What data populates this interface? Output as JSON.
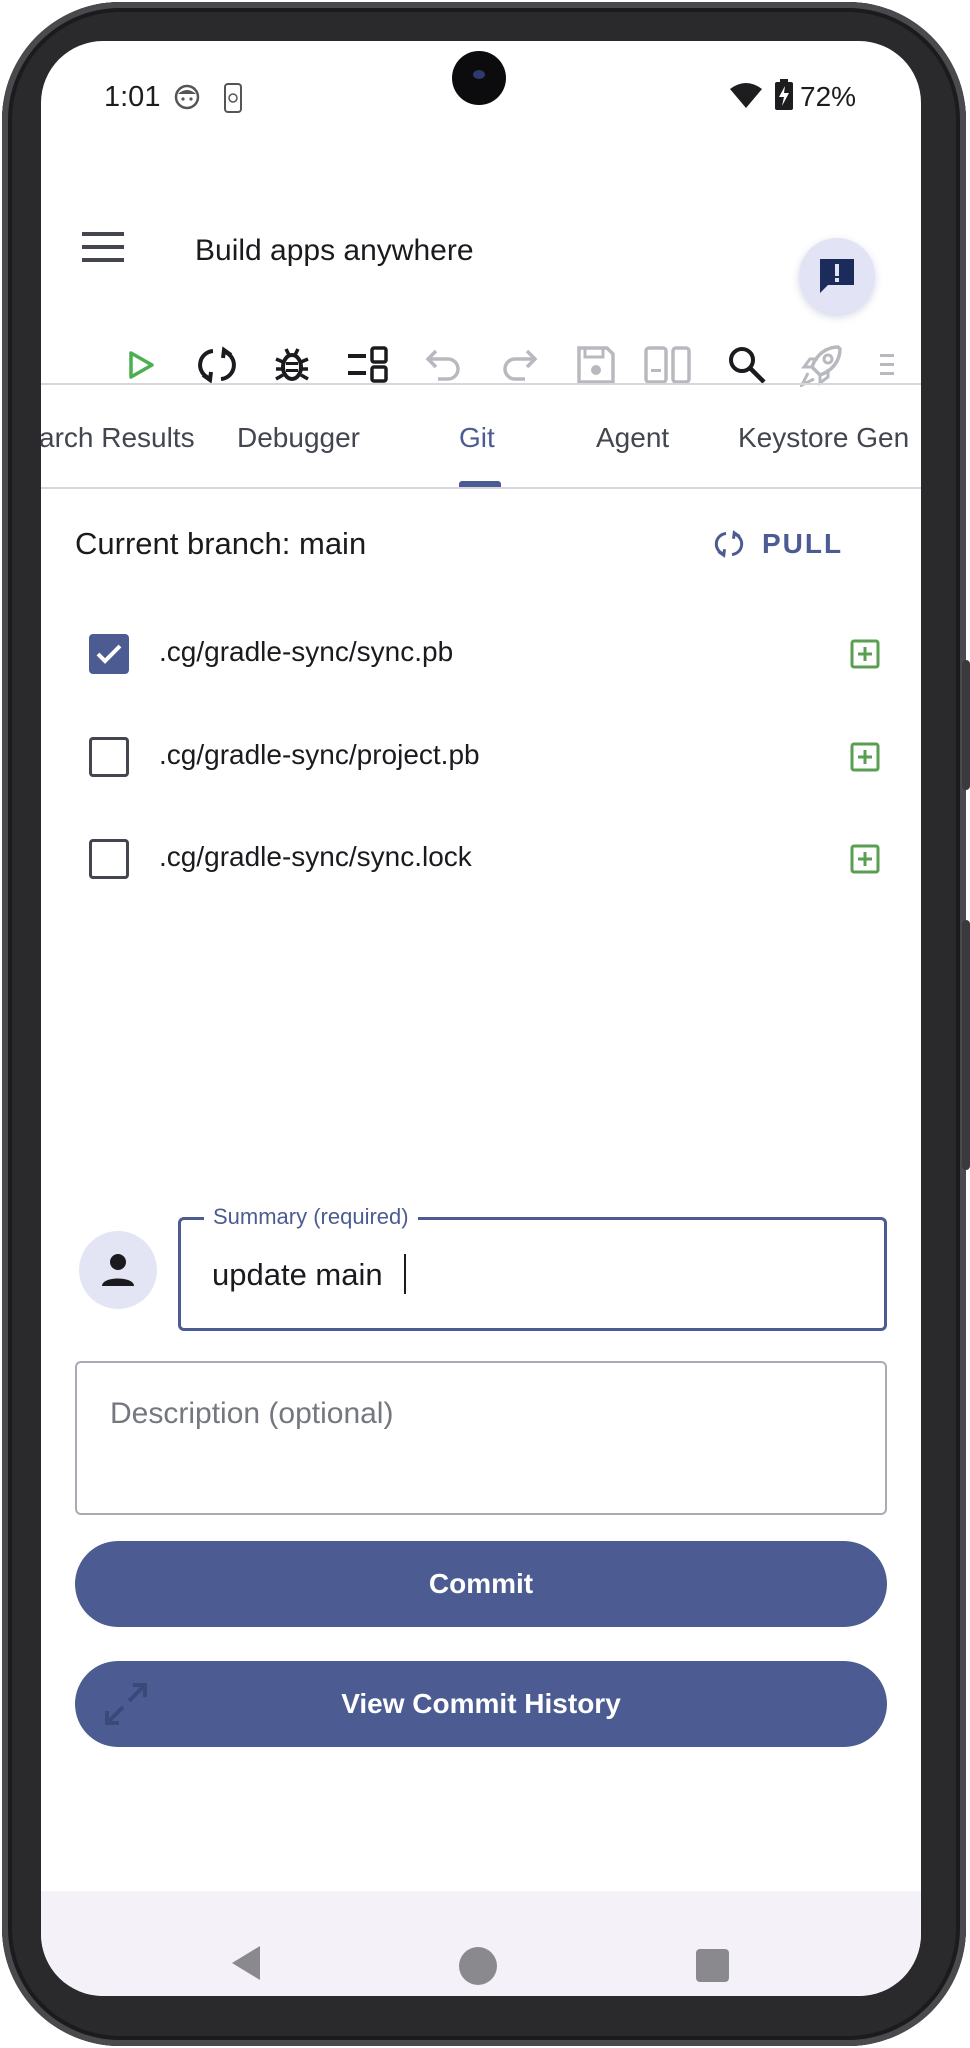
{
  "status_bar": {
    "time": "1:01",
    "battery": "72%",
    "icons": [
      "face-notification-icon",
      "device-notification-icon",
      "wifi-icon",
      "battery-charging-icon"
    ]
  },
  "app_bar": {
    "title": "Build apps anywhere",
    "menu_icon": "hamburger-menu-icon",
    "feedback_icon": "feedback-icon"
  },
  "toolbar": {
    "tools": [
      "run-icon",
      "sync-icon",
      "debug-icon",
      "layout-icon",
      "undo-icon",
      "redo-icon",
      "save-icon",
      "preview-icon",
      "search-icon",
      "launch-icon",
      "more-icon"
    ]
  },
  "tabs": {
    "items": [
      "arch Results",
      "Debugger",
      "Git",
      "Agent",
      "Keystore Gen"
    ],
    "active": "Git"
  },
  "git": {
    "branch_label": "Current branch: main",
    "pull_label": "PULL",
    "files": [
      {
        "name": ".cg/gradle-sync/sync.pb",
        "checked": true
      },
      {
        "name": ".cg/gradle-sync/project.pb",
        "checked": false
      },
      {
        "name": ".cg/gradle-sync/sync.lock",
        "checked": false
      }
    ]
  },
  "commit": {
    "summary_label": "Summary (required)",
    "summary_value": "update main",
    "description_placeholder": "Description (optional)",
    "commit_label": "Commit",
    "history_label": "View Commit History"
  },
  "colors": {
    "primary": "#4c5c92",
    "run_green": "#4caf50",
    "add_green": "#5a9e52",
    "disabled": "#b8b9bf"
  }
}
